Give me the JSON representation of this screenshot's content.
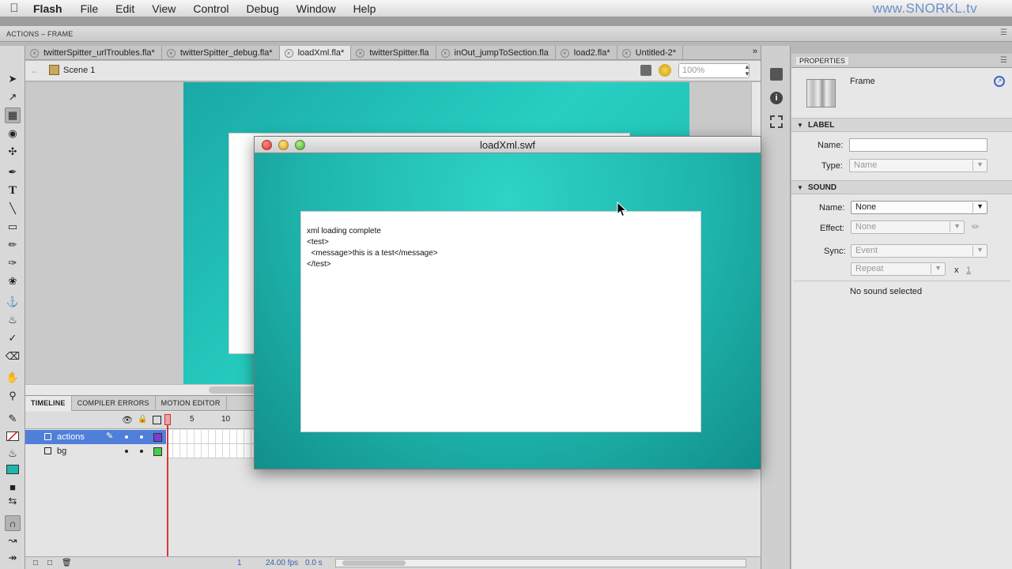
{
  "menubar": {
    "app": "Flash",
    "items": [
      "File",
      "Edit",
      "View",
      "Control",
      "Debug",
      "Window",
      "Help"
    ],
    "brand": "www.SNORKL.tv"
  },
  "actions_bar": {
    "title": "ACTIONS – FRAME"
  },
  "doc_tabs": [
    "twitterSpitter_urlTroubles.fla*",
    "twitterSpitter_debug.fla*",
    "loadXml.fla*",
    "twitterSpitter.fla",
    "inOut_jumpToSection.fla",
    "load2.fla*",
    "Untitled-2*"
  ],
  "scene": {
    "name": "Scene 1",
    "zoom": "100%"
  },
  "swf_window": {
    "title": "loadXml.swf",
    "output": "xml loading complete\n<test>\n  <message>this is a test</message>\n</test>"
  },
  "timeline": {
    "tabs": [
      "TIMELINE",
      "COMPILER ERRORS",
      "MOTION EDITOR"
    ],
    "frame_numbers": [
      "1",
      "5",
      "10"
    ],
    "layers": [
      {
        "name": "actions",
        "color": "#7a3fd0"
      },
      {
        "name": "bg",
        "color": "#44d04a"
      }
    ],
    "footer": {
      "frame": "1",
      "fps": "24.00 fps",
      "time": "0.0 s"
    }
  },
  "properties": {
    "header": "PROPERTIES",
    "type_label": "Frame",
    "label_section": "LABEL",
    "name_label": "Name:",
    "name_value": "",
    "type_field_label": "Type:",
    "type_value": "Name",
    "sound_section": "SOUND",
    "sound_name_label": "Name:",
    "sound_name_value": "None",
    "effect_label": "Effect:",
    "effect_value": "None",
    "sync_label": "Sync:",
    "sync_value": "Event",
    "repeat_value": "Repeat",
    "repeat_x": "x",
    "repeat_count": "1",
    "status": "No sound selected"
  }
}
